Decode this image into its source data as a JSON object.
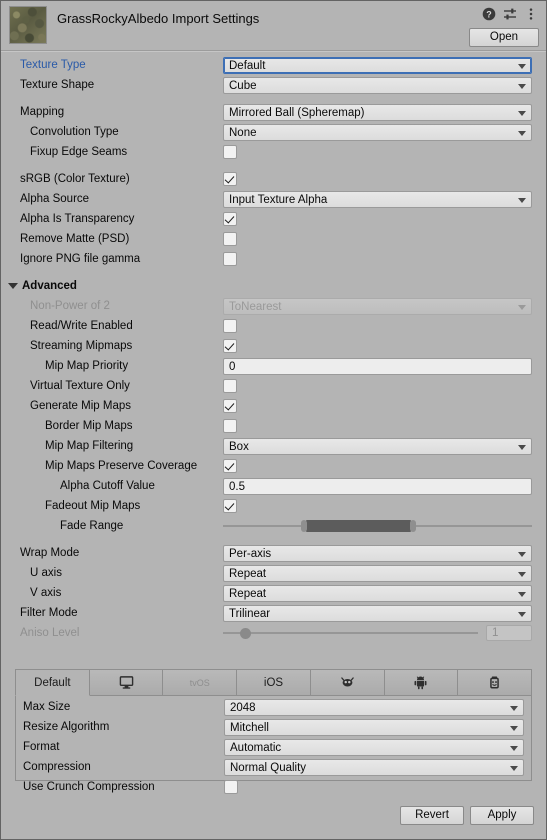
{
  "header": {
    "title": "GrassRockyAlbedo Import Settings",
    "thumbnail_name": "texture-preview",
    "open_label": "Open",
    "icons": [
      "help-icon",
      "preset-icon",
      "more-menu-icon"
    ]
  },
  "colors": {
    "window_bg": "#b4b4b4",
    "field_bg": "#e4e4e4",
    "modified_label": "#2a5aa8",
    "disabled_text": "#8f8f8f",
    "focus_border": "#3d6fb5"
  },
  "settings": [
    {
      "label": "Texture Type",
      "indent": 0,
      "type": "dropdown",
      "value": "Default",
      "focused": true,
      "modified": true
    },
    {
      "label": "Texture Shape",
      "indent": 0,
      "type": "dropdown",
      "value": "Cube"
    },
    {
      "label": "Mapping",
      "indent": 0,
      "type": "dropdown",
      "value": "Mirrored Ball (Spheremap)",
      "gap": true
    },
    {
      "label": "Convolution Type",
      "indent": 1,
      "type": "dropdown",
      "value": "None"
    },
    {
      "label": "Fixup Edge Seams",
      "indent": 1,
      "type": "checkbox",
      "checked": false
    },
    {
      "label": "sRGB (Color Texture)",
      "indent": 0,
      "type": "checkbox",
      "checked": true,
      "gap": true
    },
    {
      "label": "Alpha Source",
      "indent": 0,
      "type": "dropdown",
      "value": "Input Texture Alpha"
    },
    {
      "label": "Alpha Is Transparency",
      "indent": 0,
      "type": "checkbox",
      "checked": true
    },
    {
      "label": "Remove Matte (PSD)",
      "indent": 0,
      "type": "checkbox",
      "checked": false
    },
    {
      "label": "Ignore PNG file gamma",
      "indent": 0,
      "type": "checkbox",
      "checked": false
    },
    {
      "label": "Advanced",
      "indent": 0,
      "type": "foldout",
      "expanded": true,
      "gap": true
    },
    {
      "label": "Non-Power of 2",
      "indent": 1,
      "type": "dropdown",
      "value": "ToNearest",
      "disabled": true
    },
    {
      "label": "Read/Write Enabled",
      "indent": 1,
      "type": "checkbox",
      "checked": false
    },
    {
      "label": "Streaming Mipmaps",
      "indent": 1,
      "type": "checkbox",
      "checked": true
    },
    {
      "label": "Mip Map Priority",
      "indent": 2,
      "type": "textfield",
      "value": "0"
    },
    {
      "label": "Virtual Texture Only",
      "indent": 1,
      "type": "checkbox",
      "checked": false
    },
    {
      "label": "Generate Mip Maps",
      "indent": 1,
      "type": "checkbox",
      "checked": true
    },
    {
      "label": "Border Mip Maps",
      "indent": 2,
      "type": "checkbox",
      "checked": false
    },
    {
      "label": "Mip Map Filtering",
      "indent": 2,
      "type": "dropdown",
      "value": "Box"
    },
    {
      "label": "Mip Maps Preserve Coverage",
      "indent": 2,
      "type": "checkbox",
      "checked": true
    },
    {
      "label": "Alpha Cutoff Value",
      "indent": 3,
      "type": "textfield",
      "value": "0.5"
    },
    {
      "label": "Fadeout Mip Maps",
      "indent": 2,
      "type": "checkbox",
      "checked": true
    },
    {
      "label": "Fade Range",
      "indent": 3,
      "type": "minmax",
      "min_pct": 27,
      "max_pct": 61
    },
    {
      "label": "Wrap Mode",
      "indent": 0,
      "type": "dropdown",
      "value": "Per-axis",
      "gap": true
    },
    {
      "label": "U axis",
      "indent": 1,
      "type": "dropdown",
      "value": "Repeat"
    },
    {
      "label": "V axis",
      "indent": 1,
      "type": "dropdown",
      "value": "Repeat"
    },
    {
      "label": "Filter Mode",
      "indent": 0,
      "type": "dropdown",
      "value": "Trilinear"
    },
    {
      "label": "Aniso Level",
      "indent": 0,
      "type": "slider",
      "value": "1",
      "pct": 7,
      "disabled": true
    }
  ],
  "platform": {
    "tabs": [
      {
        "label": "Default",
        "icon": null,
        "active": true,
        "dim": false
      },
      {
        "label": "",
        "icon": "monitor-icon",
        "active": false,
        "dim": false
      },
      {
        "label": "tvOS",
        "icon": null,
        "active": false,
        "dim": true
      },
      {
        "label": "iOS",
        "icon": null,
        "active": false,
        "dim": false
      },
      {
        "label": "",
        "icon": "webgl-icon",
        "active": false,
        "dim": false
      },
      {
        "label": "",
        "icon": "android-icon",
        "active": false,
        "dim": false
      },
      {
        "label": "",
        "icon": "uwp-icon",
        "active": false,
        "dim": false
      }
    ],
    "settings": [
      {
        "label": "Max Size",
        "type": "dropdown",
        "value": "2048"
      },
      {
        "label": "Resize Algorithm",
        "type": "dropdown",
        "value": "Mitchell"
      },
      {
        "label": "Format",
        "type": "dropdown",
        "value": "Automatic"
      },
      {
        "label": "Compression",
        "type": "dropdown",
        "value": "Normal Quality"
      },
      {
        "label": "Use Crunch Compression",
        "type": "checkbox",
        "checked": false
      }
    ]
  },
  "footer": {
    "revert_label": "Revert",
    "apply_label": "Apply"
  }
}
